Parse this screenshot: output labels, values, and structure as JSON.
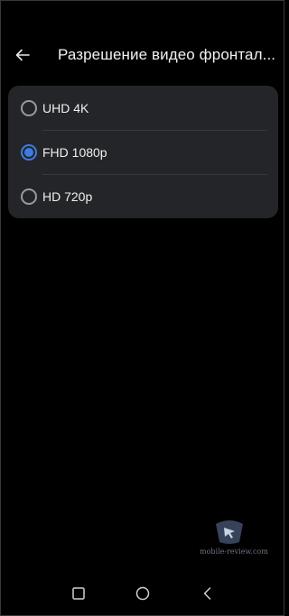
{
  "header": {
    "back_icon": "arrow-left-icon",
    "title": "Разрешение видео фронтал..."
  },
  "options": [
    {
      "label": "UHD 4K",
      "selected": false
    },
    {
      "label": "FHD 1080p",
      "selected": true
    },
    {
      "label": "HD 720p",
      "selected": false
    }
  ],
  "watermark": {
    "text": "mobile-review.com"
  },
  "navbar": {
    "recents_icon": "square-icon",
    "home_icon": "circle-icon",
    "back_icon": "triangle-back-icon"
  },
  "colors": {
    "background": "#000000",
    "card": "#242528",
    "accent": "#3f7be0"
  }
}
